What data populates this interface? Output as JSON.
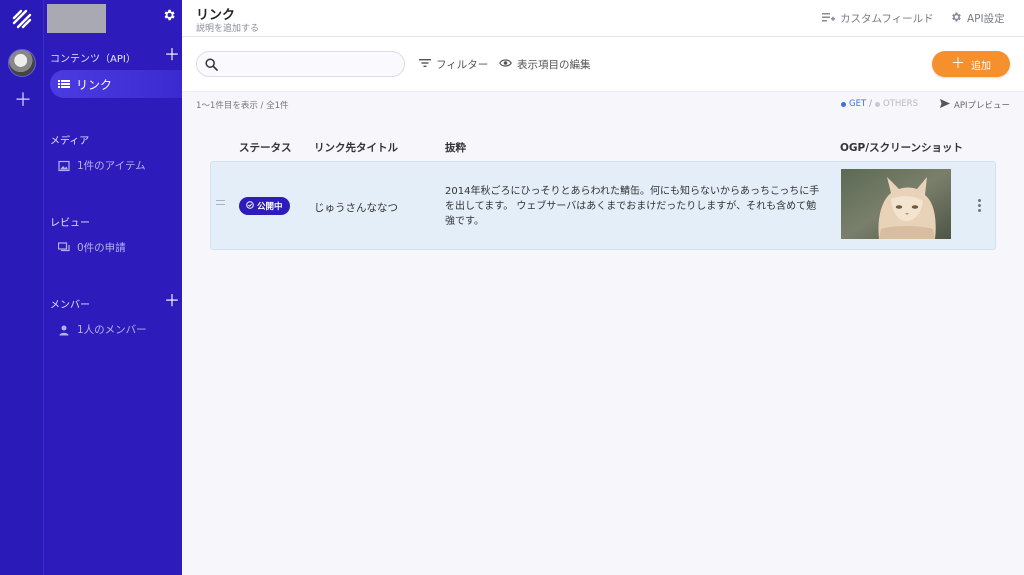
{
  "header": {
    "title": "リンク",
    "subtitle": "説明を追加する",
    "custom_fields": "カスタムフィールド",
    "api_settings": "API設定"
  },
  "sidebar": {
    "contents_label": "コンテンツ（API）",
    "active_item": "リンク",
    "media_label": "メディア",
    "media_item": "1件のアイテム",
    "review_label": "レビュー",
    "review_item": "0件の申請",
    "members_label": "メンバー",
    "members_item": "1人のメンバー"
  },
  "toolbar": {
    "search_placeholder": "",
    "filter": "フィルター",
    "edit_columns": "表示項目の編集",
    "add": "追加"
  },
  "meta": {
    "count": "1〜1件目を表示 / 全1件",
    "get": "GET",
    "separator": "/",
    "others": "OTHERS",
    "api_preview": "APIプレビュー"
  },
  "table": {
    "headers": {
      "status": "ステータス",
      "title": "リンク先タイトル",
      "excerpt": "抜粋",
      "ogp": "OGP/スクリーンショット"
    },
    "rows": [
      {
        "status": "公開中",
        "title": "じゅうさんななつ",
        "excerpt": "2014年秋ごろにひっそりとあらわれた鯖缶。何にも知らないからあっちこっちに手を出してます。 ウェブサーバはあくまでおまけだったりしますが、それも含めて勉強です。"
      }
    ]
  },
  "colors": {
    "brand": "#2d1cbb",
    "accent": "#f6902c",
    "row_bg": "#e4eef8"
  },
  "icons": [
    "microcms-logo",
    "gear-icon",
    "plus-icon",
    "list-icon",
    "image-icon",
    "review-icon",
    "member-icon",
    "search-icon",
    "filter-icon",
    "eye-icon",
    "custom-field-icon",
    "send-icon",
    "kebab-icon",
    "drag-handle-icon"
  ]
}
